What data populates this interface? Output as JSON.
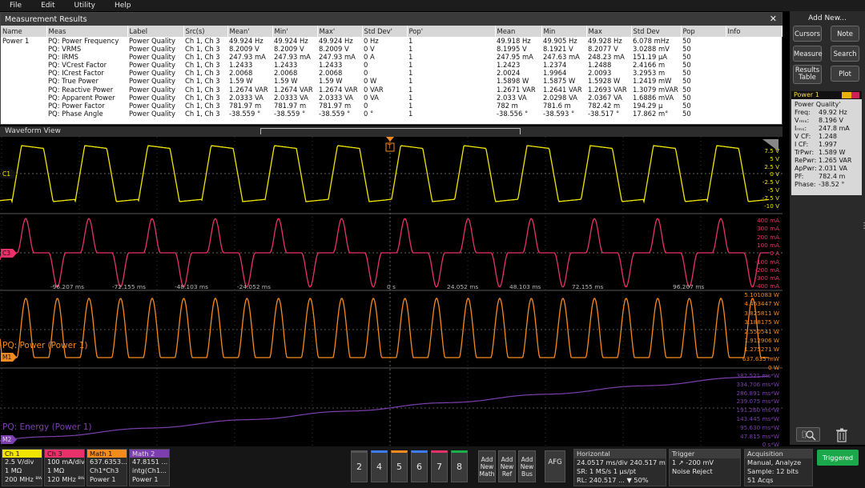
{
  "menu": [
    "File",
    "Edit",
    "Utility",
    "Help"
  ],
  "results": {
    "title": "Measurement Results",
    "close_icon": "✕",
    "columns": [
      "Name",
      "Meas",
      "Label",
      "Src(s)",
      "Mean'",
      "Min'",
      "Max'",
      "Std Dev'",
      "Pop'",
      "Mean",
      "Min",
      "Max",
      "Std Dev",
      "Pop",
      "Info"
    ],
    "rows": [
      [
        "Power 1",
        "PQ: Power Frequency",
        "Power Quality",
        "Ch 1, Ch 3",
        "49.924 Hz",
        "49.924 Hz",
        "49.924 Hz",
        "0 Hz",
        "1",
        "49.918 Hz",
        "49.905 Hz",
        "49.928 Hz",
        "6.078 mHz",
        "50",
        ""
      ],
      [
        "",
        "PQ: VRMS",
        "Power Quality",
        "Ch 1, Ch 3",
        "8.2009 V",
        "8.2009 V",
        "8.2009 V",
        "0 V",
        "1",
        "8.1995 V",
        "8.1921 V",
        "8.2077 V",
        "3.0288 mV",
        "50",
        ""
      ],
      [
        "",
        "PQ: IRMS",
        "Power Quality",
        "Ch 1, Ch 3",
        "247.93 mA",
        "247.93 mA",
        "247.93 mA",
        "0 A",
        "1",
        "247.95 mA",
        "247.63 mA",
        "248.23 mA",
        "151.19 µA",
        "50",
        ""
      ],
      [
        "",
        "PQ: VCrest Factor",
        "Power Quality",
        "Ch 1, Ch 3",
        "1.2433",
        "1.2433",
        "1.2433",
        "0",
        "1",
        "1.2423",
        "1.2374",
        "1.2488",
        "2.4166 m",
        "50",
        ""
      ],
      [
        "",
        "PQ: ICrest Factor",
        "Power Quality",
        "Ch 1, Ch 3",
        "2.0068",
        "2.0068",
        "2.0068",
        "0",
        "1",
        "2.0024",
        "1.9964",
        "2.0093",
        "3.2953 m",
        "50",
        ""
      ],
      [
        "",
        "PQ: True Power",
        "Power Quality",
        "Ch 1, Ch 3",
        "1.59 W",
        "1.59 W",
        "1.59 W",
        "0 W",
        "1",
        "1.5898 W",
        "1.5875 W",
        "1.5928 W",
        "1.2419 mW",
        "50",
        ""
      ],
      [
        "",
        "PQ: Reactive Power",
        "Power Quality",
        "Ch 1, Ch 3",
        "1.2674 VAR",
        "1.2674 VAR",
        "1.2674 VAR",
        "0 VAR",
        "1",
        "1.2671 VAR",
        "1.2641 VAR",
        "1.2693 VAR",
        "1.3079 mVAR",
        "50",
        ""
      ],
      [
        "",
        "PQ: Apparent Power",
        "Power Quality",
        "Ch 1, Ch 3",
        "2.0333 VA",
        "2.0333 VA",
        "2.0333 VA",
        "0 VA",
        "1",
        "2.033 VA",
        "2.0298 VA",
        "2.0367 VA",
        "1.6886 mVA",
        "50",
        ""
      ],
      [
        "",
        "PQ: Power Factor",
        "Power Quality",
        "Ch 1, Ch 3",
        "781.97 m",
        "781.97 m",
        "781.97 m",
        "0",
        "1",
        "782 m",
        "781.6 m",
        "782.42 m",
        "194.29 µ",
        "50",
        ""
      ],
      [
        "",
        "PQ: Phase Angle",
        "Power Quality",
        "Ch 1, Ch 3",
        "-38.559 °",
        "-38.559 °",
        "-38.559 °",
        "0 °",
        "1",
        "-38.556 °",
        "-38.593 °",
        "-38.517 °",
        "17.862 m°",
        "50",
        ""
      ]
    ]
  },
  "waveform": {
    "title": "Waveform View",
    "trigger_marker": "T",
    "ch1_axis": [
      "7.5 V",
      "5 V",
      "2.5 V",
      "0 V",
      "-2.5 V",
      "-5 V",
      "-7.5 V",
      "-10 V"
    ],
    "ch3_axis": [
      "400 mA",
      "300 mA",
      "200 mA",
      "100 mA",
      "0 A",
      "-100 mA",
      "-200 mA",
      "-300 mA",
      "-400 mA"
    ],
    "time_labels": [
      "-96.207 ms",
      "-72.155 ms",
      "-48.103 ms",
      "-24.052 ms",
      "0 s",
      "24.052 ms",
      "48.103 ms",
      "72.155 ms",
      "96.207 ms"
    ],
    "m1_axis": [
      "5.101083 W",
      "4.463447 W",
      "3.825811 W",
      "3.188175 W",
      "2.550541 W",
      "1.912906 W",
      "1.275271 W",
      "637.635 mW",
      "0 W"
    ],
    "m2_axis": [
      "382.521 ms*W",
      "334.706 ms*W",
      "286.891 ms*W",
      "239.075 ms*W",
      "191.260 ms*W",
      "143.445 ms*W",
      "95.630 ms*W",
      "47.815 ms*W",
      "0 s*W"
    ],
    "m1_label": "PQ: Power (Power 1)",
    "m2_label": "PQ: Energy (Power 1)",
    "ch1_tag": "C1",
    "ch3_tag": "C3",
    "m1_tag": "M1",
    "m2_tag": "M2",
    "colors": {
      "ch1": "#f2e600",
      "ch3": "#e8316a",
      "m1": "#f58a1f",
      "m2": "#7d3fb0"
    }
  },
  "right_panel": {
    "add_new": "Add New...",
    "buttons": [
      "Cursors",
      "Note",
      "Measure",
      "Search",
      "Results Table",
      "Plot"
    ],
    "badge_title": "Power 1",
    "badge_subtitle": "Power Quality'",
    "badge_rows": [
      [
        "Freq:",
        "49.92 Hz"
      ],
      [
        "Vᵣₘₛ:",
        "8.196 V"
      ],
      [
        "Iᵣₘₛ:",
        "247.8 mA"
      ],
      [
        "V CF:",
        "1.248"
      ],
      [
        "I CF:",
        "1.997"
      ],
      [
        "TrPwr:",
        "1.589 W"
      ],
      [
        "RePwr:",
        "1.265 VAR"
      ],
      [
        "ApPwr:",
        "2.031 VA"
      ],
      [
        "PF:",
        "782.4 m"
      ],
      [
        "Phase:",
        "-38.52 °"
      ]
    ],
    "zoom_icon": "zoom-icon",
    "trash_icon": "trash-icon"
  },
  "bottom": {
    "ch1": {
      "title": "Ch 1",
      "l1": "2.5 V/div",
      "l2": "1 MΩ",
      "l3": "200 MHz ᴮᵂ"
    },
    "ch3": {
      "title": "Ch 3",
      "l1": "100 mA/div",
      "l2": "1 MΩ",
      "l3": "120 MHz ᴮᵂ"
    },
    "math1": {
      "title": "Math 1",
      "l1": "637.6353...",
      "l2": "Ch1*Ch3",
      "l3": "Power 1"
    },
    "math2": {
      "title": "Math 2",
      "l1": "47.8151 ...",
      "l2": "intg(Ch1...",
      "l3": "Power 1"
    },
    "num_buttons": [
      "2",
      "4",
      "5",
      "6",
      "7",
      "8"
    ],
    "add_buttons": [
      [
        "Add",
        "New",
        "Math"
      ],
      [
        "Add",
        "New",
        "Ref"
      ],
      [
        "Add",
        "New",
        "Bus"
      ]
    ],
    "afg": "AFG",
    "horizontal": {
      "title": "Horizontal",
      "l1": "24.0517 ms/div 240.517 ms",
      "l2": "SR: 1 MS/s     1 µs/pt",
      "l3": "RL: 240.517 ...  ▼ 50%"
    },
    "trigger": {
      "title": "Trigger",
      "l1": "1  ↗  -200 mV",
      "l2": "Noise Reject"
    },
    "acquisition": {
      "title": "Acquisition",
      "l1": "Manual,     Analyze",
      "l2": "Sample: 12 bits",
      "l3": "51 Acqs"
    },
    "triggered": "Triggered"
  }
}
